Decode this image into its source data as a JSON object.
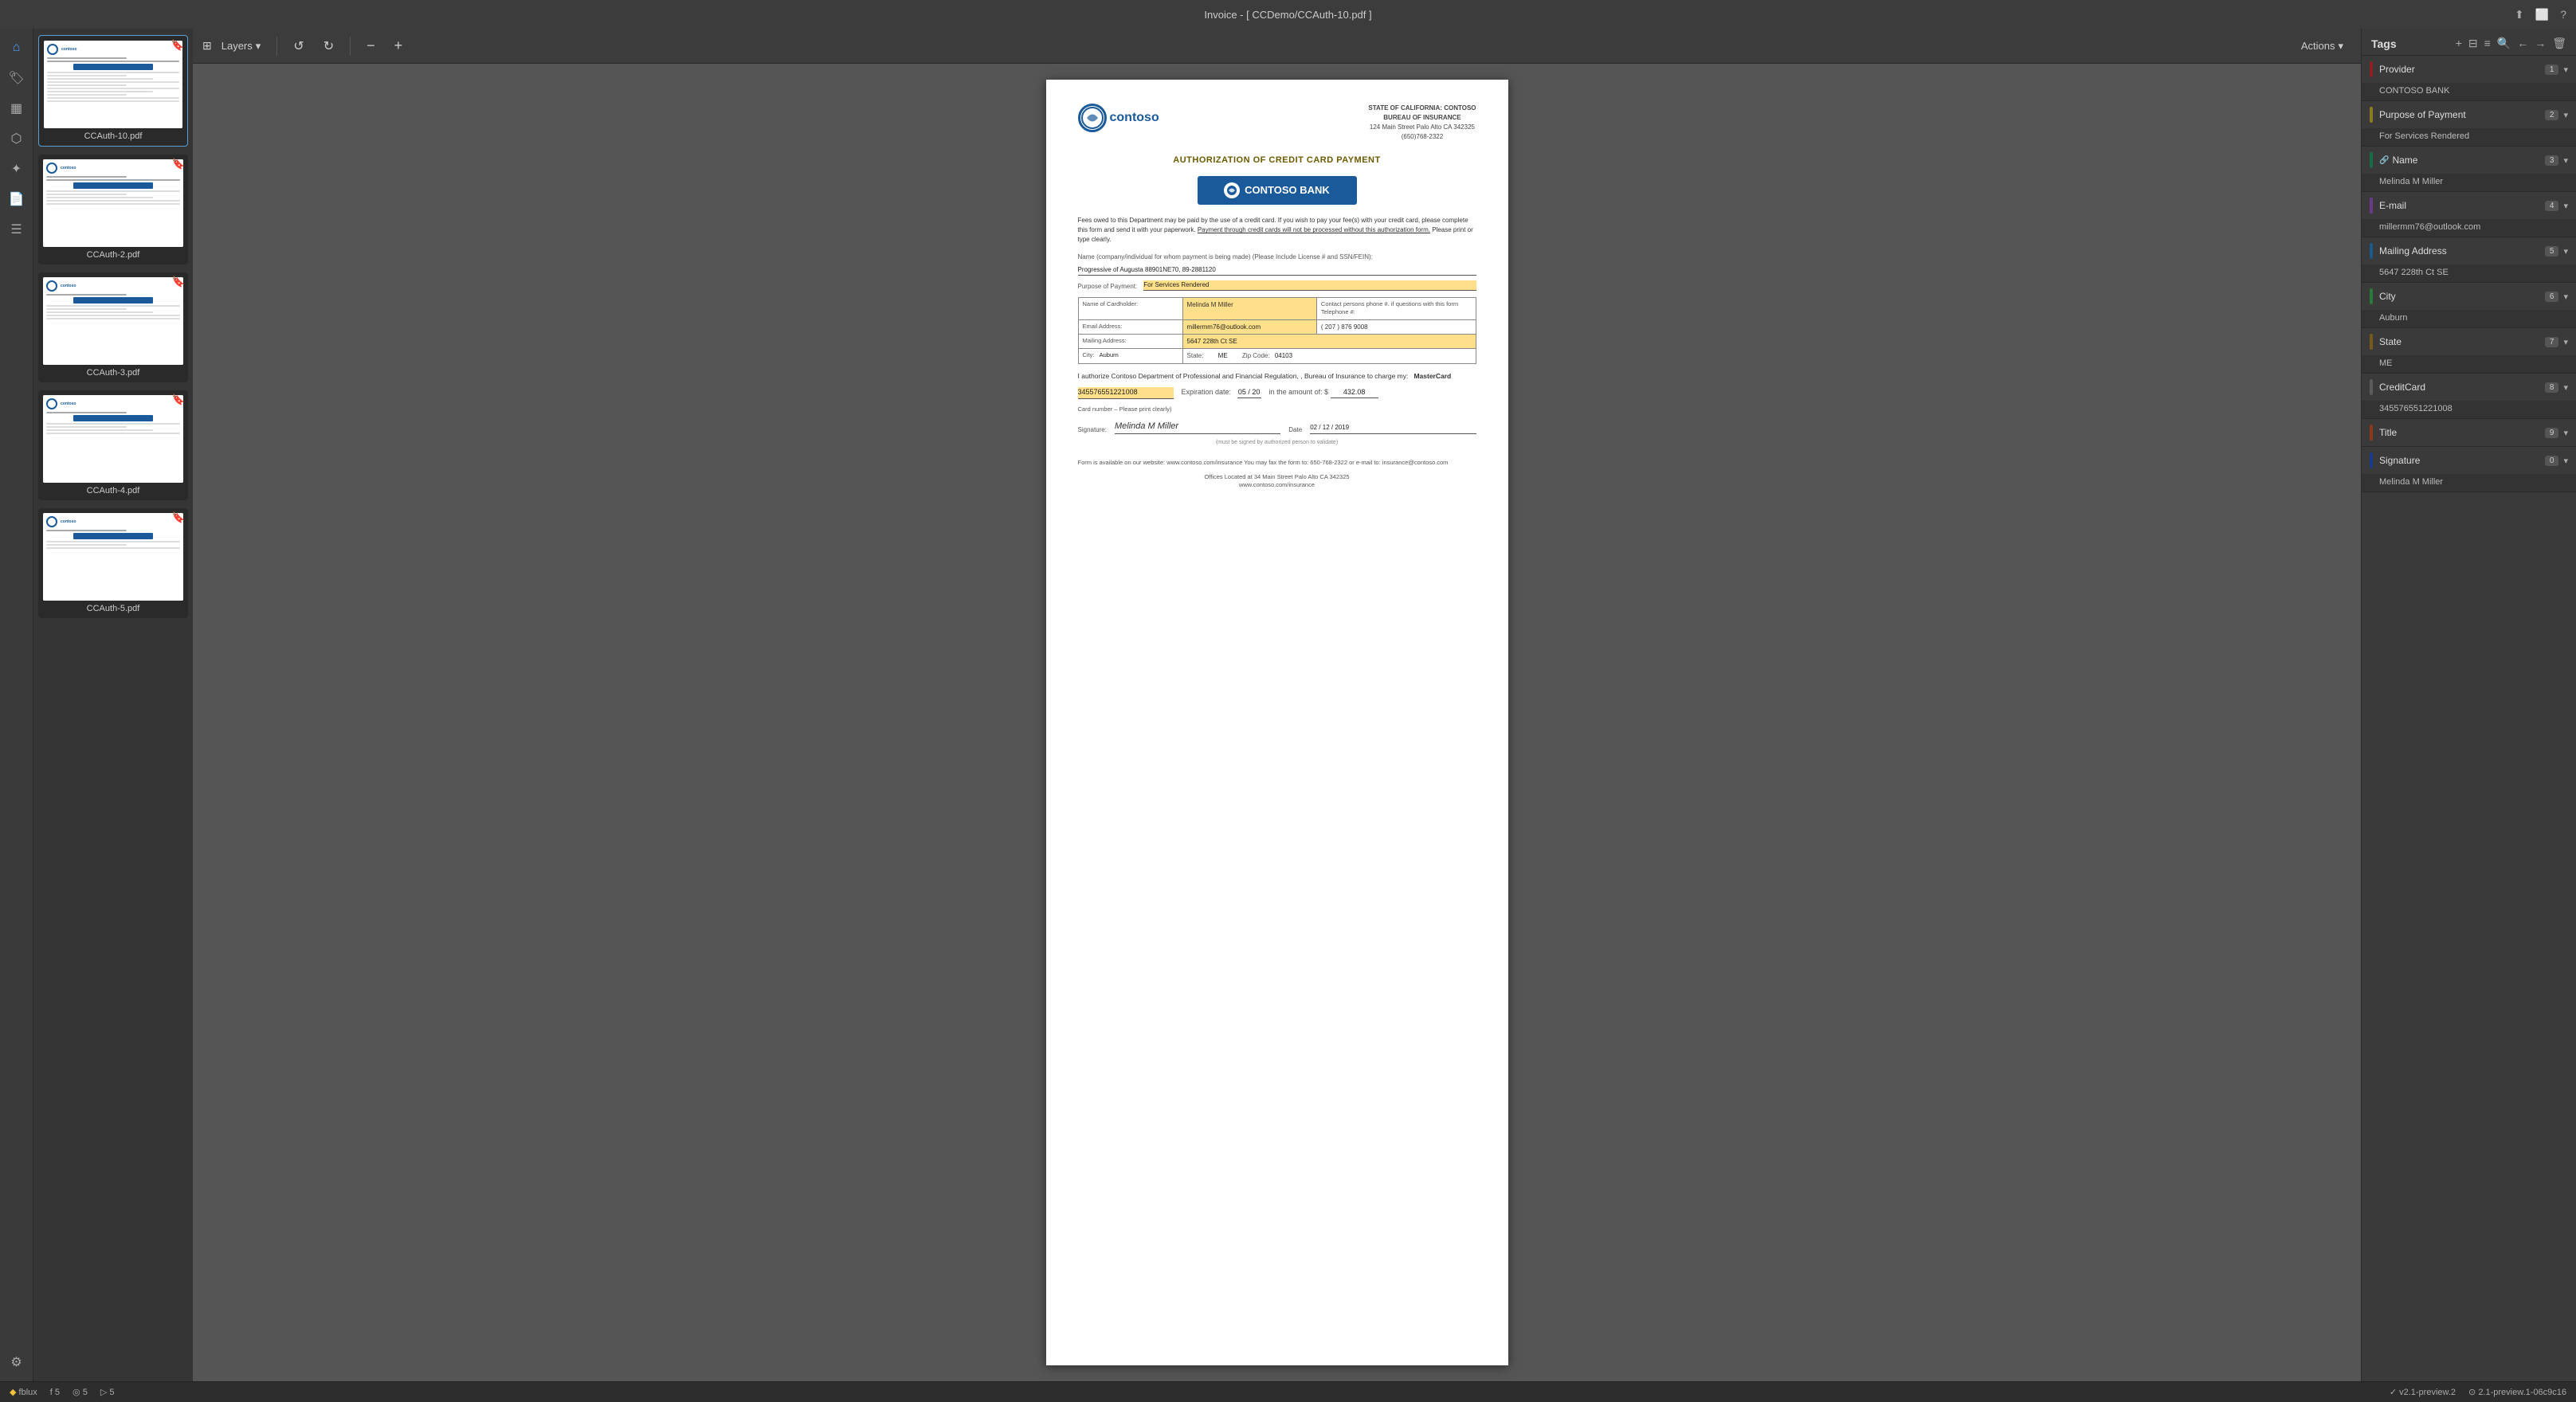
{
  "titleBar": {
    "title": "Invoice - [ CCDemo/CCAuth-10.pdf ]",
    "icons": [
      "share-icon",
      "tablet-icon",
      "help-icon"
    ]
  },
  "toolbar": {
    "layersLabel": "Layers",
    "actionsLabel": "Actions",
    "undoIcon": "↺",
    "redoIcon": "↻",
    "zoomOutIcon": "−",
    "zoomInIcon": "+"
  },
  "thumbnails": [
    {
      "label": "CCAuth-10.pdf",
      "active": true,
      "bookmark": true
    },
    {
      "label": "CCAuth-2.pdf",
      "active": false,
      "bookmark": true
    },
    {
      "label": "CCAuth-3.pdf",
      "active": false,
      "bookmark": true
    },
    {
      "label": "CCAuth-4.pdf",
      "active": false,
      "bookmark": true
    },
    {
      "label": "CCAuth-5.pdf",
      "active": false,
      "bookmark": true
    }
  ],
  "document": {
    "headerRight": {
      "line1": "STATE OF CALIFORNIA: CONTOSO",
      "line2": "BUREAU OF INSURANCE",
      "line3": "124 Main Street Palo Alto CA 342325",
      "line4": "(650)768-2322"
    },
    "logoText": "contoso",
    "title": "AUTHORIZATION OF CREDIT CARD PAYMENT",
    "bankName": "CONTOSO BANK",
    "para1": "Fees owed to this Department may be paid by the use of a credit card. If you wish to pay your fee(s) with your credit card, please complete this form and send it with your paperwork.",
    "para1link": "Payment through credit cards will not be processed without this authorization form.",
    "para1end": "Please print or type clearly.",
    "nameFieldLabel": "Name (company/individual for whom payment is being made) (Please Include License # and SSN/FEIN):",
    "nameFieldVal": "Progressive of Augusta  88901NE70, 89-2881120",
    "purposeLabel": "Purpose of Payment:",
    "purposeVal": "For Services Rendered",
    "cardholderLabel": "Name of Cardholder:",
    "cardholderVal": "Melinda M Miller",
    "contactLabel": "Contact persons phone #. if questions with this form  Telephone #:",
    "contactVal": "( 207 )  876  9008",
    "emailLabel": "Email Address:",
    "emailVal": "millermm76@outlook.com",
    "mailingLabel": "Mailing Address:",
    "mailingVal": "5647 228th Ct SE",
    "cityLabel": "City:",
    "cityVal": "Auburn",
    "stateLabel": "State:",
    "stateVal": "ME",
    "zipLabel": "Zip Code:",
    "zipVal": "04103",
    "authorizeText1": "I authorize Contoso Department of Professional and Financial Regulation, , Bureau of Insurance to charge my:",
    "authorizeCardType": "MasterCard",
    "cardNumLabel": "Card number – Please print clearly)",
    "cardNum": "345576551221008",
    "expiryLabel": "Expiration date:",
    "expiryVal": "05 / 20",
    "amountLabel": "in the amount of: $",
    "amountVal": "432.08",
    "signatureLabel": "Signature:",
    "signatureVal": "Melinda M Miller",
    "mustSign": "(must be signed by authorized person to validate)",
    "dateLabel": "Date",
    "dateVal": "02 / 12 / 2019",
    "footer1": "Form is available on our website: www.contoso.com/insurance You may fax the form to: 650-768-2322 or e-mail to: insurance@contoso.com",
    "footer2": "Offices Located at 34 Main Street Palo Alto CA 342325",
    "footer3": "www.contoso.com/insurance"
  },
  "tagsPanel": {
    "title": "Tags",
    "tags": [
      {
        "name": "Provider",
        "badge": "1",
        "color": "#8b2020",
        "value": "CONTOSO BANK"
      },
      {
        "name": "Purpose of Payment",
        "badge": "2",
        "color": "#8b7a20",
        "value": "For Services Rendered"
      },
      {
        "name": "Name",
        "badge": "3",
        "color": "#1a6b4a",
        "value": "Melinda M Miller",
        "hasIcon": true
      },
      {
        "name": "E-mail",
        "badge": "4",
        "color": "#6b3a8b",
        "value": "millermm76@outlook.com"
      },
      {
        "name": "Mailing Address",
        "badge": "5",
        "color": "#1a5a8b",
        "value": "5647 228th Ct SE"
      },
      {
        "name": "City",
        "badge": "6",
        "color": "#2a7a3a",
        "value": "Auburn"
      },
      {
        "name": "State",
        "badge": "7",
        "color": "#7a5a1a",
        "value": "ME"
      },
      {
        "name": "CreditCard",
        "badge": "8",
        "color": "#5a5a5a",
        "value": "345576551221008"
      },
      {
        "name": "Title",
        "badge": "9",
        "color": "#8b3a1a",
        "value": ""
      },
      {
        "name": "Signature",
        "badge": "0",
        "color": "#1a3a8b",
        "value": "Melinda M Miller"
      }
    ]
  },
  "statusBar": {
    "appName": "fblux",
    "fCount": "5",
    "eCount": "5",
    "pCount": "5",
    "version": "v2.1-preview.2",
    "build": "2.1-preview.1-06c9c16"
  },
  "sidebarIcons": [
    {
      "name": "home-icon",
      "symbol": "⌂",
      "active": true
    },
    {
      "name": "tag-icon",
      "symbol": "🏷",
      "active": false
    },
    {
      "name": "layers-icon",
      "symbol": "⊞",
      "active": false
    },
    {
      "name": "connector-icon",
      "symbol": "⬡",
      "active": false
    },
    {
      "name": "bulb-icon",
      "symbol": "💡",
      "active": false
    },
    {
      "name": "document-icon",
      "symbol": "📄",
      "active": false
    },
    {
      "name": "list-icon",
      "symbol": "☰",
      "active": false
    },
    {
      "name": "settings-icon",
      "symbol": "⚙",
      "active": false
    }
  ]
}
